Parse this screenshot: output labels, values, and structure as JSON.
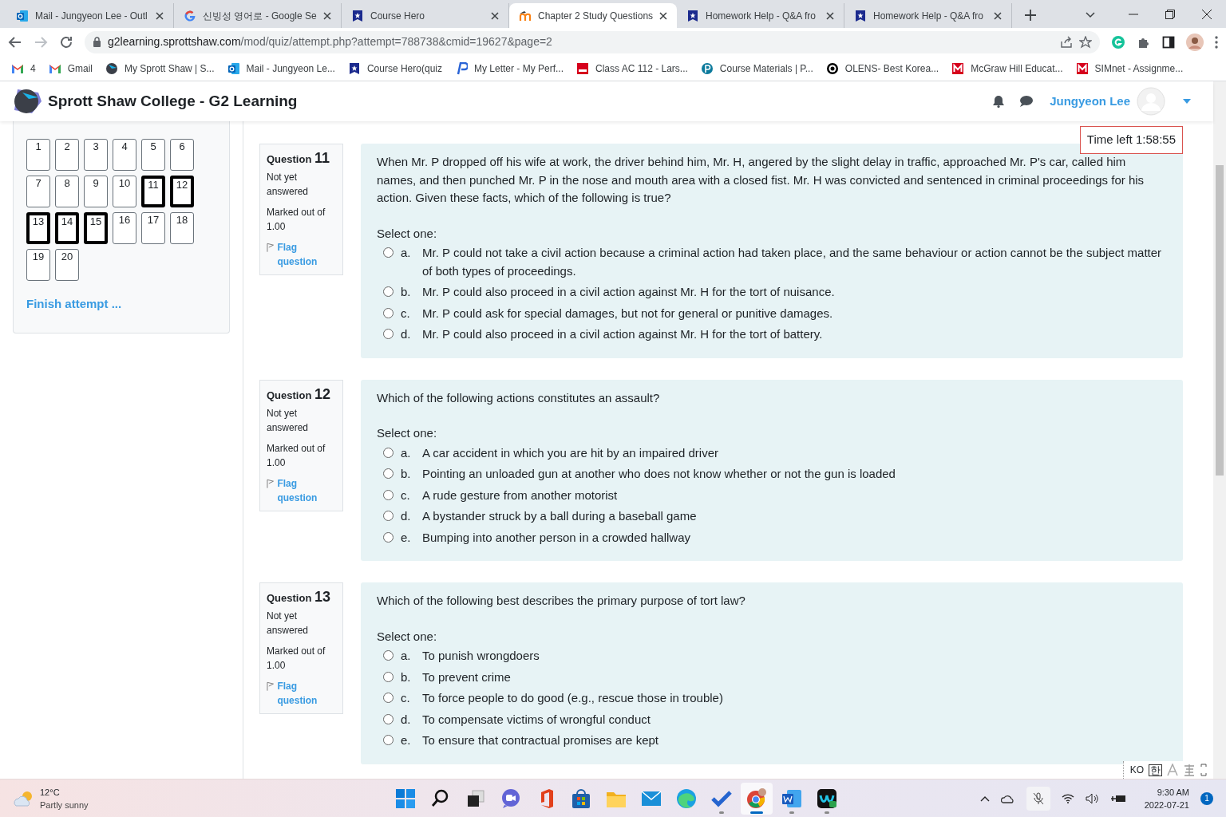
{
  "browser": {
    "tabs": [
      {
        "kind": "outlook",
        "title": "Mail - Jungyeon Lee - Outl",
        "selected": false
      },
      {
        "kind": "google",
        "title": "신빙성 영어로 - Google Se",
        "selected": false
      },
      {
        "kind": "coursehero",
        "title": "Course Hero",
        "selected": false
      },
      {
        "kind": "moodle",
        "title": "Chapter 2 Study Questions",
        "selected": true
      },
      {
        "kind": "coursehero",
        "title": "Homework Help - Q&A fro",
        "selected": false
      },
      {
        "kind": "coursehero",
        "title": "Homework Help - Q&A fro",
        "selected": false
      }
    ],
    "url_host": "g2learning.sprottshaw.com",
    "url_path": "/mod/quiz/attempt.php?attempt=788738&cmid=19627&page=2",
    "bookmarks": [
      {
        "kind": "gmail",
        "label": "4"
      },
      {
        "kind": "gmail",
        "label": "Gmail"
      },
      {
        "kind": "sprott",
        "label": "My Sprott Shaw | S..."
      },
      {
        "kind": "outlook",
        "label": "Mail - Jungyeon Le..."
      },
      {
        "kind": "coursehero",
        "label": "Course Hero(quiz"
      },
      {
        "kind": "p",
        "label": "My Letter - My Perf..."
      },
      {
        "kind": "mcgraw",
        "label": "Class AC 112 - Lars..."
      },
      {
        "kind": "pcircle",
        "label": "Course Materials | P..."
      },
      {
        "kind": "olens",
        "label": "OLENS- Best Korea..."
      },
      {
        "kind": "m",
        "label": "McGraw Hill Educat..."
      },
      {
        "kind": "m",
        "label": "SIMnet - Assignme..."
      }
    ]
  },
  "site": {
    "title": "Sprott Shaw College - G2 Learning",
    "user": "Jungyeon Lee"
  },
  "quiz_nav": {
    "buttons": [
      {
        "label": "1",
        "selected": false
      },
      {
        "label": "2",
        "selected": false
      },
      {
        "label": "3",
        "selected": false
      },
      {
        "label": "4",
        "selected": false
      },
      {
        "label": "5",
        "selected": false
      },
      {
        "label": "6",
        "selected": false
      },
      {
        "label": "7",
        "selected": false
      },
      {
        "label": "8",
        "selected": false
      },
      {
        "label": "9",
        "selected": false
      },
      {
        "label": "10",
        "selected": false
      },
      {
        "label": "11",
        "selected": true
      },
      {
        "label": "12",
        "selected": true
      },
      {
        "label": "13",
        "selected": true
      },
      {
        "label": "14",
        "selected": true
      },
      {
        "label": "15",
        "selected": true
      },
      {
        "label": "16",
        "selected": false
      },
      {
        "label": "17",
        "selected": false
      },
      {
        "label": "18",
        "selected": false
      },
      {
        "label": "19",
        "selected": false
      },
      {
        "label": "20",
        "selected": false
      }
    ],
    "finish": "Finish attempt ..."
  },
  "timer": "Time left 1:58:55",
  "questions": [
    {
      "label": "Question",
      "number": "11",
      "status": "Not yet answered",
      "marked": "Marked out of",
      "score": "1.00",
      "flag": "Flag question",
      "text": "When Mr. P dropped off his wife at work, the driver behind him, Mr. H, angered by the slight delay in traffic, approached Mr. P's car, called him names, and then punched Mr. P in the nose and mouth area with a closed fist. Mr. H was convicted and sentenced in criminal proceedings for his action. Given these facts, which of the following is true?",
      "prompt": "Select one:",
      "options": [
        {
          "letter": "a.",
          "text": "Mr. P could not take a civil action because a criminal action had taken place, and the same behaviour or action cannot be the subject matter of both types of proceedings.",
          "selected": false
        },
        {
          "letter": "b.",
          "text": "Mr. P could also proceed in a civil action against Mr. H for the tort of nuisance.",
          "selected": false
        },
        {
          "letter": "c.",
          "text": "Mr. P could ask for special damages, but not for general or punitive damages.",
          "selected": false
        },
        {
          "letter": "d.",
          "text": "Mr. P could also proceed in a civil action against Mr. H for the tort of battery.",
          "selected": false
        }
      ]
    },
    {
      "label": "Question",
      "number": "12",
      "status": "Not yet answered",
      "marked": "Marked out of",
      "score": "1.00",
      "flag": "Flag question",
      "text": "Which of the following actions constitutes an assault?",
      "prompt": "Select one:",
      "options": [
        {
          "letter": "a.",
          "text": "A car accident in which you are hit by an impaired driver",
          "selected": false
        },
        {
          "letter": "b.",
          "text": "Pointing an unloaded gun at another who does not know whether or not the gun is loaded",
          "selected": false
        },
        {
          "letter": "c.",
          "text": "A rude gesture from another motorist",
          "selected": false
        },
        {
          "letter": "d.",
          "text": "A bystander struck by a ball during a baseball game",
          "selected": false
        },
        {
          "letter": "e.",
          "text": "Bumping into another person in a crowded hallway",
          "selected": false
        }
      ]
    },
    {
      "label": "Question",
      "number": "13",
      "status": "Not yet answered",
      "marked": "Marked out of",
      "score": "1.00",
      "flag": "Flag question",
      "text": "Which of the following best describes the primary purpose of tort law?",
      "prompt": "Select one:",
      "options": [
        {
          "letter": "a.",
          "text": "To punish wrongdoers",
          "selected": false
        },
        {
          "letter": "b.",
          "text": "To prevent crime",
          "selected": false
        },
        {
          "letter": "c.",
          "text": "To force people to do good (e.g., rescue those in trouble)",
          "selected": false
        },
        {
          "letter": "d.",
          "text": "To compensate victims of wrongful conduct",
          "selected": false
        },
        {
          "letter": "e.",
          "text": "To ensure that contractual promises are kept",
          "selected": false
        }
      ]
    }
  ],
  "ime": {
    "mode": "KO",
    "hangul": "한"
  },
  "taskbar": {
    "weather_temp": "12°C",
    "weather_text": "Partly sunny",
    "apps": [
      {
        "kind": "start",
        "running": false,
        "selected": false
      },
      {
        "kind": "search",
        "running": false,
        "selected": false
      },
      {
        "kind": "taskview",
        "running": false,
        "selected": false
      },
      {
        "kind": "chat",
        "running": false,
        "selected": false
      },
      {
        "kind": "office",
        "running": false,
        "selected": false
      },
      {
        "kind": "store",
        "running": false,
        "selected": false
      },
      {
        "kind": "folder",
        "running": false,
        "selected": false
      },
      {
        "kind": "mail",
        "running": false,
        "selected": false
      },
      {
        "kind": "edge",
        "running": false,
        "selected": false
      },
      {
        "kind": "todo",
        "running": true,
        "selected": false
      },
      {
        "kind": "chrome",
        "running": true,
        "selected": true
      },
      {
        "kind": "word",
        "running": true,
        "selected": false
      },
      {
        "kind": "webex",
        "running": true,
        "selected": false
      }
    ],
    "time": "9:30 AM",
    "date": "2022-07-21",
    "notifications": "1"
  }
}
